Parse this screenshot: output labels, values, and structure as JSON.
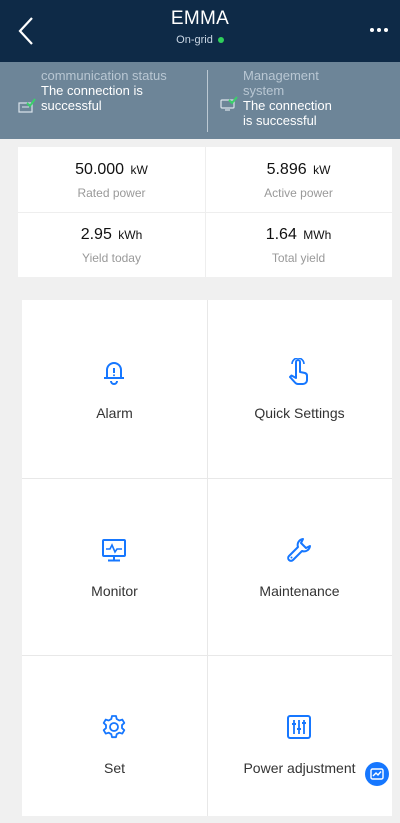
{
  "header": {
    "title": "EMMA",
    "subtitle": "On-grid",
    "status_dot_color": "#2fcf5b",
    "back_icon": "chevron-left-icon",
    "more_icon": "more-icon"
  },
  "status_bar": {
    "communication": {
      "label": "communication status",
      "value_line1": "The connection is",
      "value_line2": "successful"
    },
    "management": {
      "label_line1": "Management",
      "label_line2": "system",
      "value_line1": "The connection",
      "value_line2": "is successful"
    }
  },
  "metrics": [
    {
      "value": "50.000",
      "unit": "kW",
      "label": "Rated power"
    },
    {
      "value": "5.896",
      "unit": "kW",
      "label": "Active power"
    },
    {
      "value": "2.95",
      "unit": "kWh",
      "label": "Yield today"
    },
    {
      "value": "1.64",
      "unit": "MWh",
      "label": "Total yield"
    }
  ],
  "tiles": [
    {
      "label": "Alarm",
      "icon": "bell-icon"
    },
    {
      "label": "Quick Settings",
      "icon": "hand-pointer-icon"
    },
    {
      "label": "Monitor",
      "icon": "monitor-icon"
    },
    {
      "label": "Maintenance",
      "icon": "wrench-icon"
    },
    {
      "label": "Set",
      "icon": "gear-icon"
    },
    {
      "label": "Power adjustment",
      "icon": "sliders-icon"
    }
  ],
  "colors": {
    "header_bg": "#0e2a47",
    "status_bg": "#6d8598",
    "accent": "#1677ff"
  }
}
